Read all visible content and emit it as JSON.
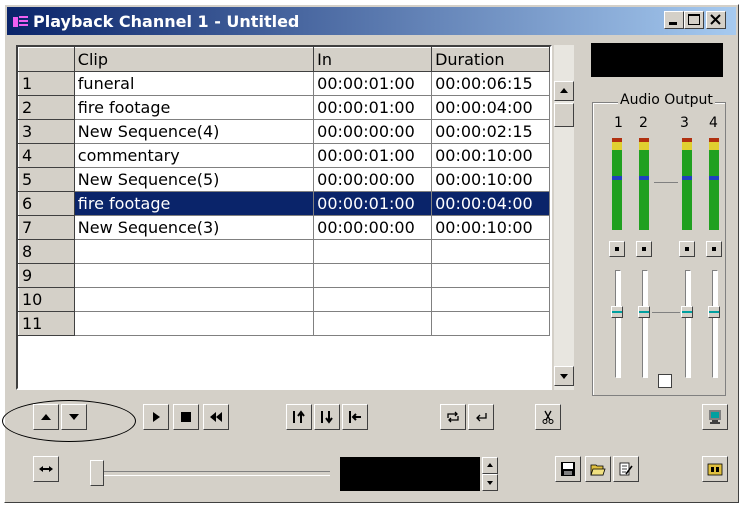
{
  "window": {
    "title": "Playback Channel 1 - Untitled"
  },
  "columns": [
    "Clip",
    "In",
    "Duration"
  ],
  "rows": [
    {
      "n": "1",
      "clip": "funeral",
      "in": "00:00:01:00",
      "duration": "00:00:06:15"
    },
    {
      "n": "2",
      "clip": "fire footage",
      "in": "00:00:01:00",
      "duration": "00:00:04:00"
    },
    {
      "n": "3",
      "clip": "New Sequence(4)",
      "in": "00:00:00:00",
      "duration": "00:00:02:15"
    },
    {
      "n": "4",
      "clip": "commentary",
      "in": "00:00:01:00",
      "duration": "00:00:10:00"
    },
    {
      "n": "5",
      "clip": "New Sequence(5)",
      "in": "00:00:00:00",
      "duration": "00:00:10:00"
    },
    {
      "n": "6",
      "clip": "fire footage",
      "in": "00:00:01:00",
      "duration": "00:00:04:00"
    },
    {
      "n": "7",
      "clip": "New Sequence(3)",
      "in": "00:00:00:00",
      "duration": "00:00:10:00"
    },
    {
      "n": "8",
      "clip": "",
      "in": "",
      "duration": ""
    },
    {
      "n": "9",
      "clip": "",
      "in": "",
      "duration": ""
    },
    {
      "n": "10",
      "clip": "",
      "in": "",
      "duration": ""
    },
    {
      "n": "11",
      "clip": "",
      "in": "",
      "duration": ""
    }
  ],
  "selected_row": "6",
  "audio": {
    "label": "Audio Output",
    "channels": [
      "1",
      "2",
      "3",
      "4"
    ]
  },
  "colors": {
    "selection": "#0a246a",
    "meter_green": "#20a020"
  }
}
